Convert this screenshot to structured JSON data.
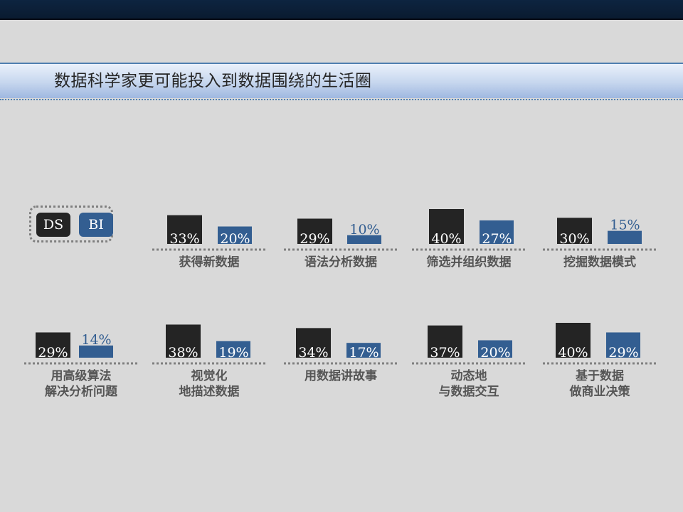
{
  "page": {
    "title": "数据科学家更可能投入到数据围绕的生活圈"
  },
  "legend": {
    "ds_label": "DS",
    "bi_label": "BI"
  },
  "colors": {
    "ds": "#242424",
    "bi": "#335e91",
    "label_outside": "#335e91"
  },
  "chart_data": {
    "type": "bar",
    "title": "",
    "legend_position": "top-left",
    "grid": false,
    "ylim": [
      0,
      40
    ],
    "series": [
      {
        "name": "DS",
        "values": [
          33,
          29,
          40,
          30,
          29,
          38,
          34,
          37,
          40
        ]
      },
      {
        "name": "BI",
        "values": [
          20,
          10,
          27,
          15,
          14,
          19,
          17,
          20,
          29
        ]
      }
    ],
    "categories": [
      "获得新数据",
      "语法分析数据",
      "筛选并组织数据",
      "挖掘数据模式",
      "用高级算法\n解决分析问题",
      "视觉化\n地描述数据",
      "用数据讲故事",
      "动态地\n与数据交互",
      "基于数据\n做商业决策"
    ],
    "category_lines": [
      [
        "获得新数据"
      ],
      [
        "语法分析数据"
      ],
      [
        "筛选并组织数据"
      ],
      [
        "挖掘数据模式"
      ],
      [
        "用高级算法",
        "解决分析问题"
      ],
      [
        "视觉化",
        "地描述数据"
      ],
      [
        "用数据讲故事"
      ],
      [
        "动态地",
        "与数据交互"
      ],
      [
        "基于数据",
        "做商业决策"
      ]
    ],
    "value_labels_ds": [
      "33%",
      "29%",
      "40%",
      "30%",
      "29%",
      "38%",
      "34%",
      "37%",
      "40%"
    ],
    "value_labels_bi": [
      "20%",
      "10%",
      "27%",
      "15%",
      "14%",
      "19%",
      "17%",
      "20%",
      "29%"
    ]
  }
}
